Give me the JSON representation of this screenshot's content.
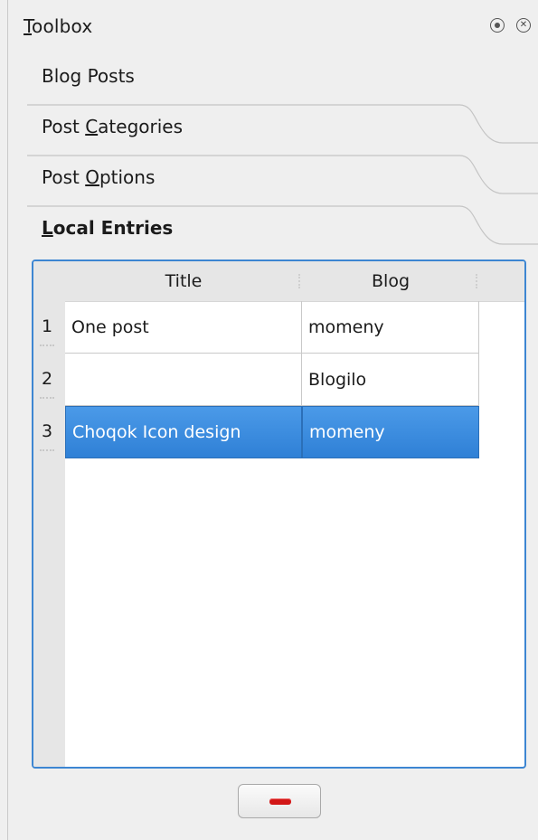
{
  "window": {
    "title_first": "T",
    "title_rest": "oolbox",
    "float_icon": "float-icon",
    "close_icon": "close-icon",
    "close_glyph": "✕"
  },
  "tabs": [
    {
      "pre": "",
      "mnemonic": "",
      "post": "Blog Posts",
      "active": false
    },
    {
      "pre": "Post ",
      "mnemonic": "C",
      "post": "ategories",
      "active": false
    },
    {
      "pre": "Post ",
      "mnemonic": "O",
      "post": "ptions",
      "active": false
    },
    {
      "pre": "",
      "mnemonic": "L",
      "post": "ocal Entries",
      "active": true
    }
  ],
  "table": {
    "columns": [
      "Title",
      "Blog"
    ],
    "rows": [
      {
        "num": "1",
        "title": "One post",
        "blog": "momeny",
        "selected": false
      },
      {
        "num": "2",
        "title": "",
        "blog": "Blogilo",
        "selected": false
      },
      {
        "num": "3",
        "title": "Choqok Icon design",
        "blog": "momeny",
        "selected": true
      }
    ]
  },
  "remove_button": {
    "icon": "minus-icon",
    "color": "#d21717"
  },
  "colors": {
    "accent": "#3d86d2",
    "selection": "#2f80d6"
  }
}
